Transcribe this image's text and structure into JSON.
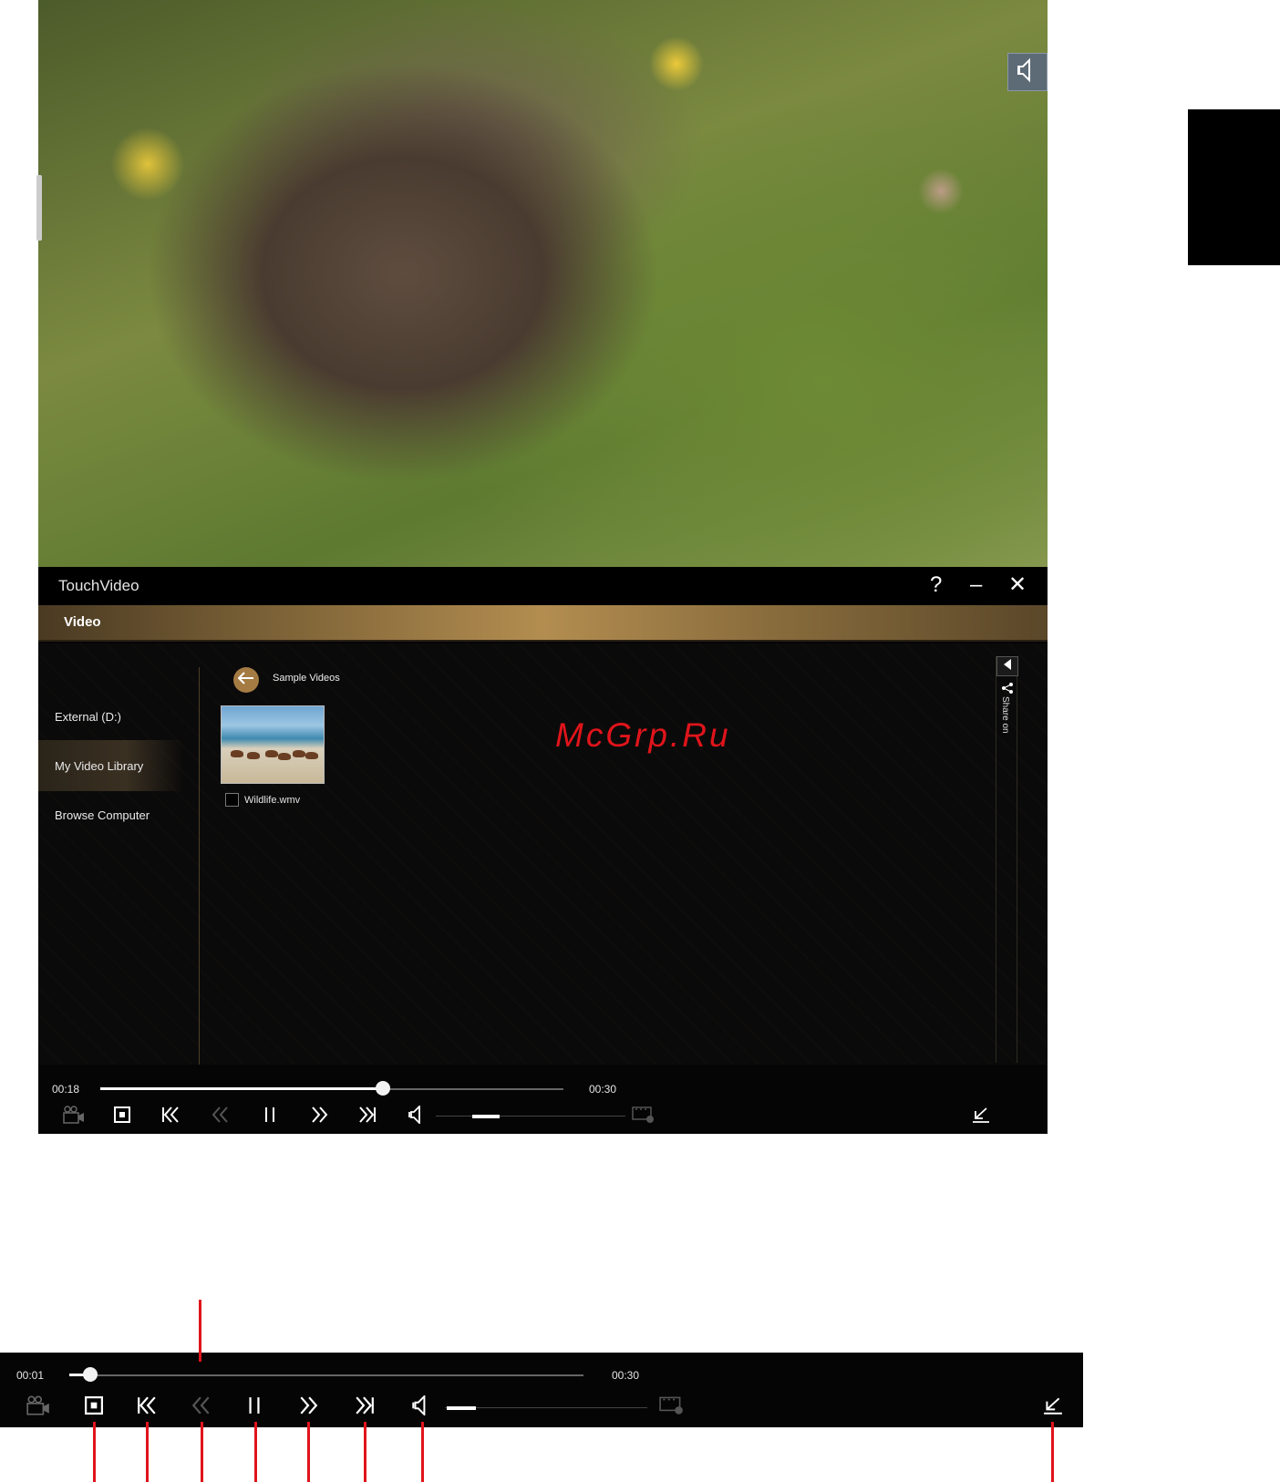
{
  "video": {
    "overlay_button_icon": "speaker-icon"
  },
  "app": {
    "title": "TouchVideo",
    "window_buttons": {
      "help": "?",
      "minimize": "–",
      "close": "✕"
    },
    "tab": "Video",
    "sidebar": {
      "items": [
        "External (D:)",
        "My Video Library",
        "Browse Computer"
      ],
      "active_index": 1
    },
    "breadcrumb": "Sample Videos",
    "files": [
      {
        "name": "Wildlife.wmv",
        "checked": false
      }
    ],
    "share_label": "Share on",
    "watermark": "McGrp.Ru"
  },
  "player": {
    "current_time": "00:18",
    "total_time": "00:30",
    "progress": 0.61,
    "volume": 0.3
  },
  "enlarged_player": {
    "current_time": "00:01",
    "total_time": "00:30",
    "progress": 0.04,
    "volume": 0.3
  },
  "colors": {
    "accent_gold": "#a47b43",
    "callout_red": "#e0141b"
  }
}
